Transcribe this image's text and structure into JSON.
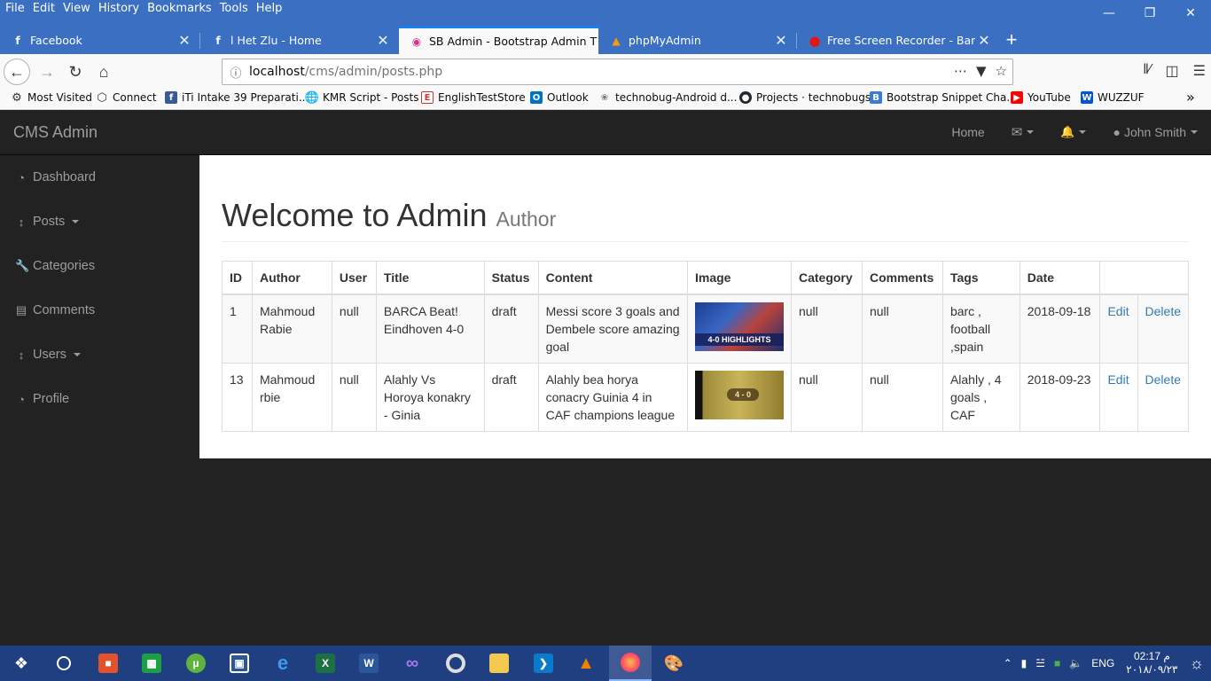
{
  "browser": {
    "menu": [
      "File",
      "Edit",
      "View",
      "History",
      "Bookmarks",
      "Tools",
      "Help"
    ],
    "tabs": [
      {
        "title": "Facebook",
        "icon": "facebook-icon"
      },
      {
        "title": "l Het Zlu - Home",
        "icon": "facebook-icon"
      },
      {
        "title": "SB Admin - Bootstrap Admin T",
        "icon": "sb-admin-icon"
      },
      {
        "title": "phpMyAdmin",
        "icon": "phpmyadmin-icon"
      },
      {
        "title": "Free Screen Recorder - Bandica",
        "icon": "bandicam-icon"
      }
    ],
    "url": {
      "host": "localhost",
      "path": "/cms/admin/posts.php"
    },
    "bookmarks": [
      "Most Visited",
      "Connect",
      "iTi Intake 39 Preparati...",
      "KMR Script - Posts",
      "EnglishTestStore",
      "Outlook",
      "technobug-Android d...",
      "Projects · technobugs",
      "Bootstrap Snippet Cha...",
      "YouTube",
      "WUZZUF"
    ]
  },
  "app": {
    "brand": "CMS Admin",
    "nav": {
      "home": "Home",
      "user": "John Smith"
    },
    "sidebar": [
      {
        "label": "Dashboard",
        "icon": "dashboard-icon"
      },
      {
        "label": "Posts",
        "icon": "arrows-v-icon"
      },
      {
        "label": "Categories",
        "icon": "wrench-icon"
      },
      {
        "label": "Comments",
        "icon": "file-icon"
      },
      {
        "label": "Users",
        "icon": "arrows-v-icon"
      },
      {
        "label": "Profile",
        "icon": "dashboard-icon"
      }
    ],
    "heading": {
      "title": "Welcome to Admin",
      "sub": "Author"
    },
    "table": {
      "headers": [
        "ID",
        "Author",
        "User",
        "Title",
        "Status",
        "Content",
        "Image",
        "Category",
        "Comments",
        "Tags",
        "Date",
        ""
      ],
      "rows": [
        {
          "id": "1",
          "author": "Mahmoud Rabie",
          "user": "null",
          "title": "BARCA Beat! Eindhoven 4-0",
          "status": "draft",
          "content": "Messi score 3 goals and Dembele score amazing goal",
          "image_text": "4-0 HIGHLIGHTS",
          "category": "null",
          "comments": "null",
          "tags": "barc , football ,spain",
          "date": "2018-09-18",
          "edit": "Edit",
          "delete": "Delete"
        },
        {
          "id": "13",
          "author": "Mahmoud rbie",
          "user": "null",
          "title": "Alahly Vs Horoya konakry - Ginia",
          "status": "draft",
          "content": "Alahly bea horya conacry Guinia 4 in CAF champions league",
          "image_text": "4 - 0",
          "category": "null",
          "comments": "null",
          "tags": "Alahly , 4 goals , CAF",
          "date": "2018-09-23",
          "edit": "Edit",
          "delete": "Delete"
        }
      ]
    }
  },
  "taskbar": {
    "lang": "ENG",
    "time": "02:17 م",
    "date": "٢٠١٨/٠٩/٢٣"
  }
}
